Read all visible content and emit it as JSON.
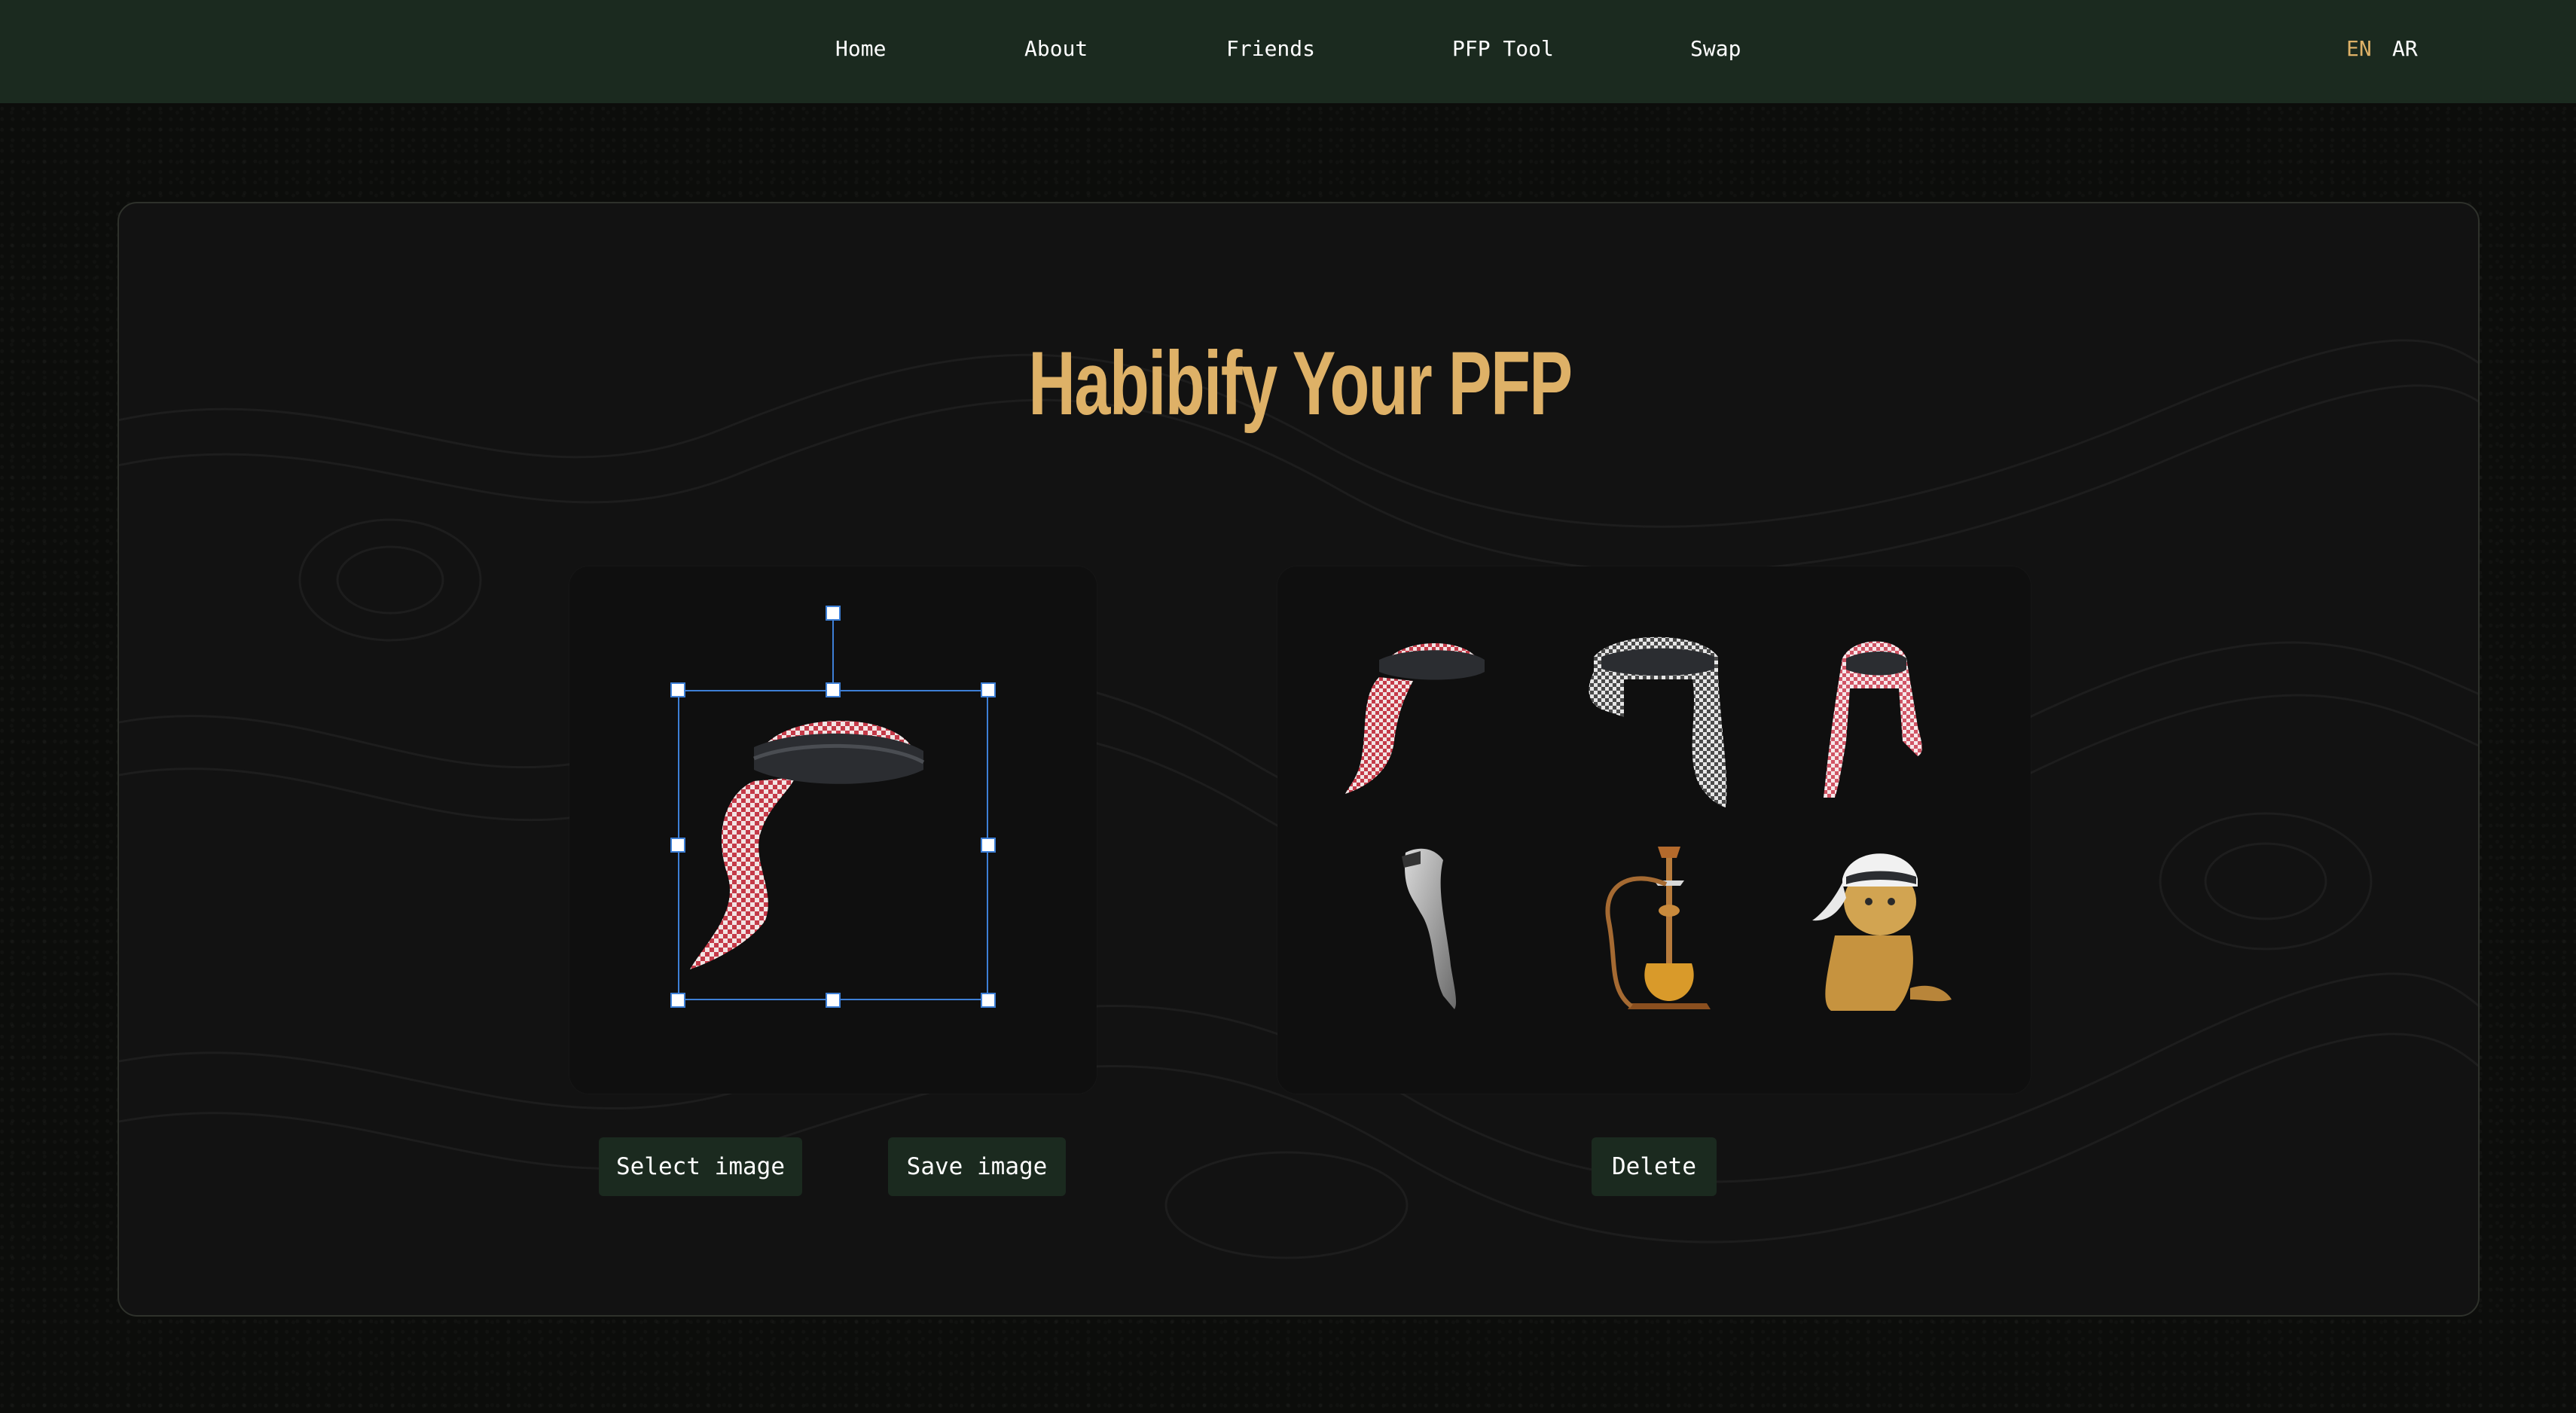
{
  "nav": {
    "links": [
      "Home",
      "About",
      "Friends",
      "PFP Tool",
      "Swap"
    ],
    "lang_en": "EN",
    "lang_ar": "AR"
  },
  "page": {
    "title": "Habibify Your PFP"
  },
  "editor": {
    "selected_item": "red-keffiyeh-with-agal"
  },
  "gallery": {
    "items": [
      "red-keffiyeh-with-agal",
      "grey-keffiyeh-with-agal",
      "pink-keffiyeh-front",
      "grey-scarf",
      "hookah",
      "cat-with-keffiyeh"
    ]
  },
  "buttons": {
    "select_image": "Select image",
    "save_image": "Save image",
    "delete": "Delete"
  },
  "colors": {
    "nav_bg": "#1b2a1f",
    "accent_gold": "#deb167",
    "selection_blue": "#3d7fd6"
  }
}
